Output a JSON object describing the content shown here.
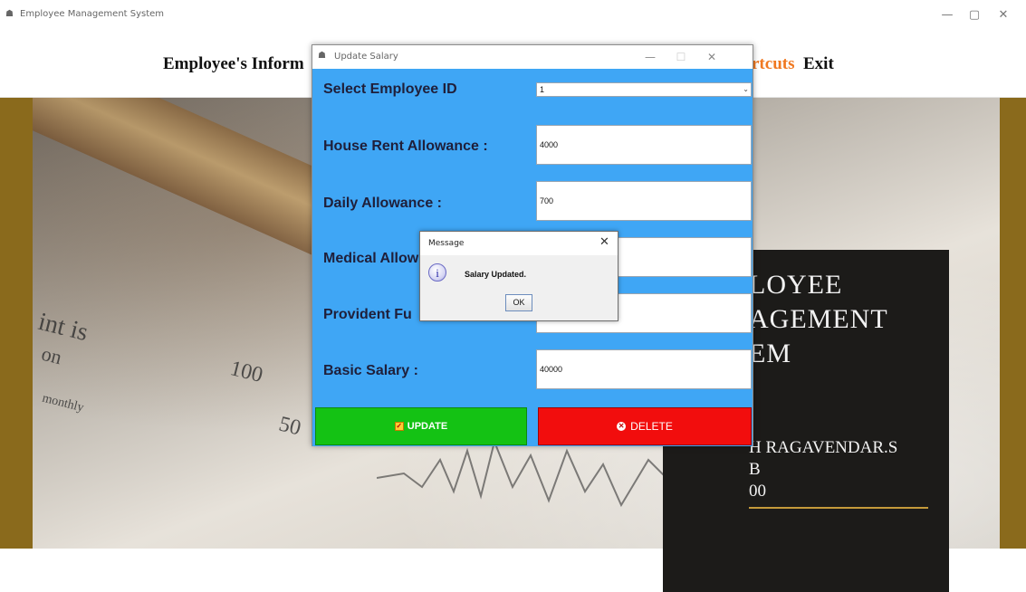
{
  "main_window": {
    "title": "Employee Management System",
    "controls": {
      "minimize": "—",
      "restore": "▢",
      "close": "✕"
    }
  },
  "menu": {
    "employee_info": "Employee's Inform",
    "shortcuts": "rtcuts",
    "exit": "Exit"
  },
  "background_panel": {
    "line1": "LOYEE",
    "line2": "AGEMENT",
    "line3": "EM",
    "line4": "H RAGAVENDAR.S",
    "line5": "B",
    "line6": "00"
  },
  "photo_text": {
    "t1": "int is",
    "t2": "on",
    "t3": "100",
    "t4": "50",
    "t5": "monthly"
  },
  "update_dialog": {
    "title": "Update Salary",
    "controls": {
      "minimize": "—",
      "maximize": "☐",
      "close": "✕"
    },
    "fields": {
      "employee_id_label": "Select Employee ID",
      "employee_id_value": "1",
      "hra_label": "House Rent Allowance :",
      "hra_value": "4000",
      "da_label": "Daily Allowance :",
      "da_value": "700",
      "medical_label": "Medical Allow",
      "medical_value": "",
      "pf_label": "Provident Fu",
      "pf_value": "",
      "basic_label": "Basic Salary :",
      "basic_value": "40000"
    },
    "buttons": {
      "update": "UPDATE",
      "delete": "DELETE"
    }
  },
  "message_dialog": {
    "title": "Message",
    "text": "Salary Updated.",
    "ok": "OK",
    "close": "✕"
  },
  "colors": {
    "dialog_body": "#3fa6f5",
    "update_button": "#14c214",
    "delete_button": "#f20d0d",
    "menu_accent": "#f07820",
    "frame_brown": "#8a6a1c"
  }
}
